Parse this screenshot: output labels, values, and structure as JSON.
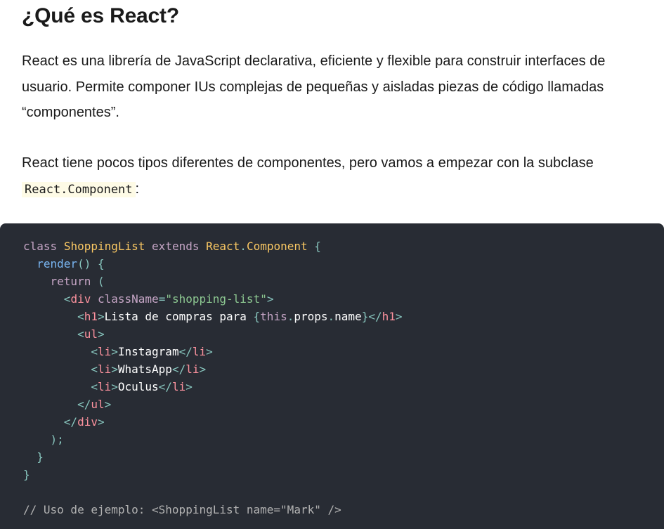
{
  "heading": "¿Qué es React?",
  "intro": {
    "paragraph1": "React es una librería de JavaScript declarativa, eficiente y flexible para construir interfaces de usuario. Permite componer IUs complejas de pequeñas y aisladas piezas de código llamadas “componentes”.",
    "paragraph2_text": "React tiene pocos tipos diferentes de componentes, pero vamos a empezar con la subclase",
    "paragraph2_code": "React.Component",
    "paragraph2_tail": ":"
  },
  "code": {
    "l1": {
      "kw": "class",
      "cls": "ShoppingList",
      "kw2": "extends",
      "cls2": "React",
      "dot": ".",
      "cls3": "Component",
      "brace": "{"
    },
    "l2": {
      "fn": "render",
      "parens": "()",
      "brace": "{"
    },
    "l3": {
      "kw": "return",
      "paren": "("
    },
    "l4": {
      "open": "<",
      "tag": "div",
      "attr": "className",
      "eq": "=",
      "str": "\"shopping-list\"",
      "close": ">"
    },
    "l5": {
      "open": "<",
      "tag": "h1",
      "close": ">",
      "text": "Lista de compras para ",
      "bopen": "{",
      "this": "this",
      "dot1": ".",
      "props": "props",
      "dot2": ".",
      "name": "name",
      "bclose": "}",
      "copen": "</",
      "ctag": "h1",
      "cclose": ">"
    },
    "l6": {
      "open": "<",
      "tag": "ul",
      "close": ">"
    },
    "l7": {
      "open": "<",
      "tag": "li",
      "close": ">",
      "text": "Instagram",
      "copen": "</",
      "ctag": "li",
      "cclose": ">"
    },
    "l8": {
      "open": "<",
      "tag": "li",
      "close": ">",
      "text": "WhatsApp",
      "copen": "</",
      "ctag": "li",
      "cclose": ">"
    },
    "l9": {
      "open": "<",
      "tag": "li",
      "close": ">",
      "text": "Oculus",
      "copen": "</",
      "ctag": "li",
      "cclose": ">"
    },
    "l10": {
      "copen": "</",
      "ctag": "ul",
      "cclose": ">"
    },
    "l11": {
      "copen": "</",
      "ctag": "div",
      "cclose": ">"
    },
    "l12": {
      "text": ");"
    },
    "l13": {
      "text": "}"
    },
    "l14": {
      "text": "}"
    },
    "comment": "// Uso de ejemplo: <ShoppingList name=\"Mark\" />"
  },
  "colors": {
    "code_background": "#282c34",
    "inline_code_background": "#fefbe6"
  }
}
